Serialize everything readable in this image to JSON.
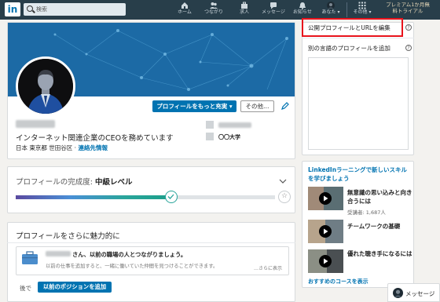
{
  "nav": {
    "logo": "in",
    "search_placeholder": "検索",
    "items": [
      {
        "label": "ホーム",
        "icon": "home-icon"
      },
      {
        "label": "つながり",
        "icon": "network-icon"
      },
      {
        "label": "求人",
        "icon": "jobs-icon"
      },
      {
        "label": "メッセージ",
        "icon": "messaging-icon"
      },
      {
        "label": "お知らせ",
        "icon": "bell-icon"
      },
      {
        "label": "あなた ▾",
        "icon": "avatar-icon"
      },
      {
        "label": "その他 ▾",
        "icon": "grid-icon"
      }
    ],
    "premium_line1": "プレミアム1か月無",
    "premium_line2": "料トライアル"
  },
  "profile": {
    "more_button": "プロフィールをもっと充実 ▾",
    "other_button": "その他…",
    "headline": "インターネット関連企業のCEOを務めています",
    "location": "日本 東京都 世田谷区",
    "separator": "·",
    "contact_link": "連絡先情報",
    "education": "〇〇大学"
  },
  "strength": {
    "label": "プロフィールの完成度:",
    "level": "中級レベル",
    "progress": 0.6
  },
  "attractive": {
    "title": "プロフィールをさらに魅力的に",
    "suggestion_title": "さん、以前の職場の人とつながりましょう。",
    "suggestion_desc": "以前の仕事を追加すると、一緒に働いていた仲間を見つけることができます。",
    "see_more": "…さらに表示",
    "later": "後で",
    "add_position": "以前のポジションを追加"
  },
  "sidebar": {
    "edit_public_profile": "公開プロフィールとURLを編集",
    "add_language_profile": "別の言語のプロフィールを追加",
    "learning_title": "LinkedInラーニングで新しいスキルを学びましょう",
    "courses": [
      {
        "title": "無意識の思い込みと向き合うには",
        "viewers": "受講者: 1,687人"
      },
      {
        "title": "チームワークの基礎",
        "viewers": ""
      },
      {
        "title": "優れた聴き手になるには",
        "viewers": ""
      }
    ],
    "recommended_link": "おすすめのコースを表示"
  },
  "messaging": {
    "label": "メッセージ"
  },
  "colors": {
    "accent": "#0073b1",
    "nav_bg": "#283e4a",
    "highlight_border": "#e8131c"
  }
}
